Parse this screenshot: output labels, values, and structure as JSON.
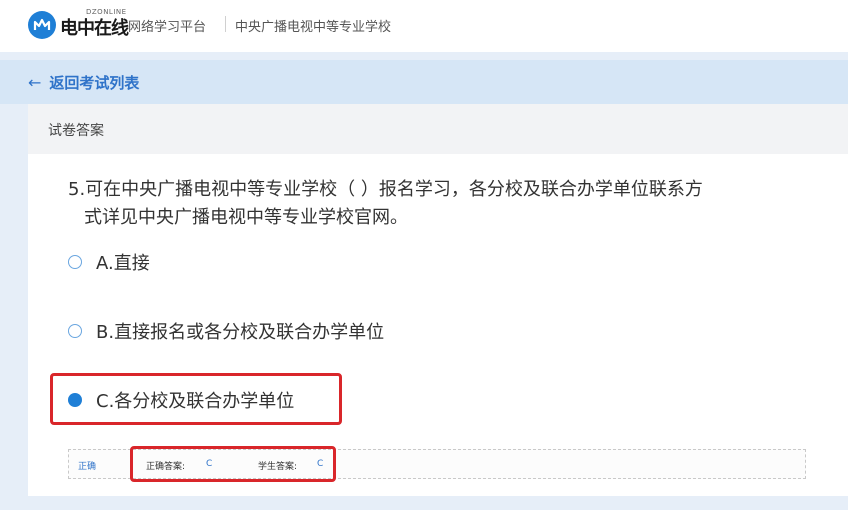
{
  "header": {
    "logo_text": "电中在线",
    "logo_subtext": "DZONLINE",
    "platform_label": "网络学习平台",
    "school_name": "中央广播电视中等专业学校"
  },
  "nav": {
    "back_label": "返回考试列表",
    "back_arrow": "←"
  },
  "card": {
    "title": "试卷答案"
  },
  "question": {
    "line1": "5.可在中央广播电视中等专业学校（ ）报名学习，各分校及联合办学单位联系方",
    "line2": "式详见中央广播电视中等专业学校官网。"
  },
  "options": [
    {
      "label": "A.直接",
      "selected": false
    },
    {
      "label": "B.直接报名或各分校及联合办学单位",
      "selected": false
    },
    {
      "label": "C.各分校及联合办学单位",
      "selected": true
    }
  ],
  "answer": {
    "status": "正确",
    "correct_label": "正确答案:",
    "correct_value": "C",
    "student_label": "学生答案:",
    "student_value": "C"
  },
  "colors": {
    "accent": "#1f7fd6",
    "link": "#2f73c9",
    "highlight": "#d9262a",
    "band": "#e6eef8"
  }
}
